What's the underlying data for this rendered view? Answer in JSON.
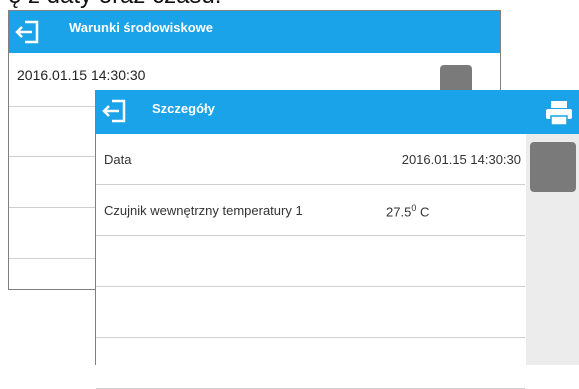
{
  "caption_partial": "ę z daty oraz czasu.",
  "back_window": {
    "title": "Warunki środowiskowe",
    "first_row": "2016.01.15  14:30:30"
  },
  "front_window": {
    "title": "Szczegóły",
    "rows": [
      {
        "label": "Data",
        "value": "2016.01.15  14:30:30"
      },
      {
        "label": "Czujnik wewnętrzny temperatury 1",
        "value_number": "27.5",
        "value_sup": "0",
        "value_unit": " C"
      }
    ]
  },
  "colors": {
    "titlebar": "#1aa3e8",
    "thumb": "#7a7a7a"
  },
  "icons": {
    "exit": "exit-arrow-icon",
    "print": "printer-icon"
  }
}
